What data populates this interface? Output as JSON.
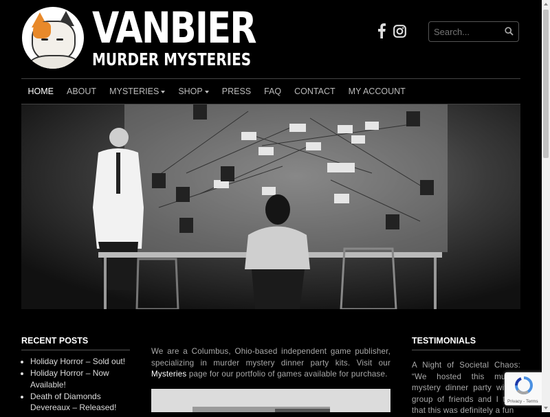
{
  "brand": {
    "title": "VANBIER",
    "subtitle": "MURDER MYSTERIES"
  },
  "social": {
    "icons": [
      "facebook-icon",
      "instagram-icon"
    ]
  },
  "search": {
    "placeholder": "Search..."
  },
  "nav": {
    "items": [
      {
        "label": "HOME",
        "active": true,
        "dropdown": false
      },
      {
        "label": "ABOUT",
        "active": false,
        "dropdown": false
      },
      {
        "label": "MYSTERIES",
        "active": false,
        "dropdown": true
      },
      {
        "label": "SHOP",
        "active": false,
        "dropdown": true
      },
      {
        "label": "PRESS",
        "active": false,
        "dropdown": false
      },
      {
        "label": "FAQ",
        "active": false,
        "dropdown": false
      },
      {
        "label": "CONTACT",
        "active": false,
        "dropdown": false
      },
      {
        "label": "MY ACCOUNT",
        "active": false,
        "dropdown": false
      }
    ]
  },
  "recent_posts": {
    "title": "RECENT POSTS",
    "items": [
      "Holiday Horror – Sold out!",
      "Holiday Horror – Now Available!",
      "Death of Diamonds Devereaux – Released!"
    ]
  },
  "intro": {
    "before": "We are a Columbus, Ohio-based independent game publisher, specializing in murder mystery dinner party kits. Visit our ",
    "link": "Mysteries",
    "after": " page for our portfolio of games available for purchase."
  },
  "testimonials": {
    "title": "TESTIMONIALS",
    "text": "A Night of Societal Chaos: “We hosted this murder mystery dinner party with a group of friends and I think that this was definitely a fun"
  },
  "recaptcha": {
    "links": "Privacy - Terms"
  },
  "colors": {
    "background": "#000000",
    "text": "#cccccc",
    "heading": "#ffffff",
    "accent_orange": "#e8892a"
  }
}
